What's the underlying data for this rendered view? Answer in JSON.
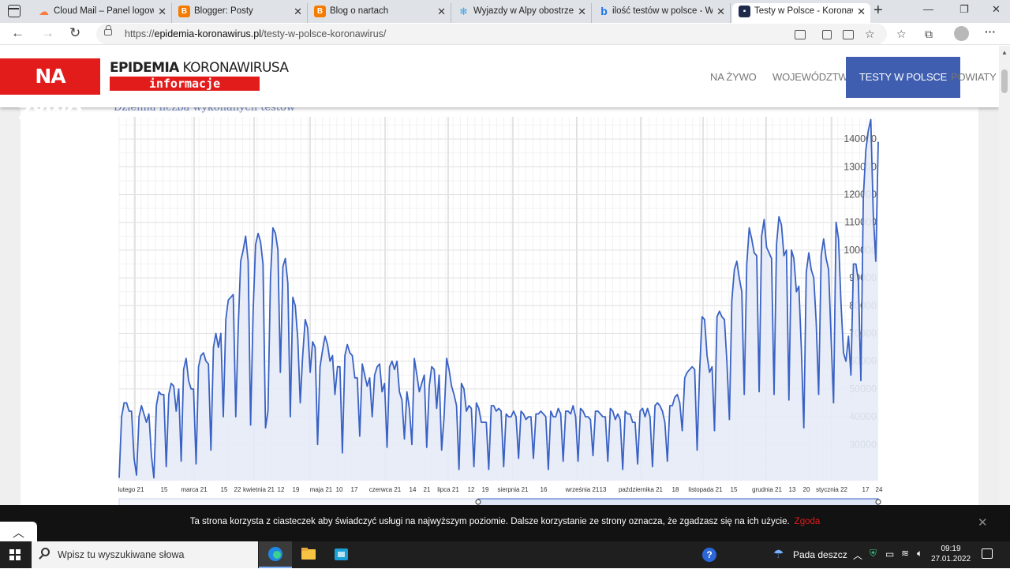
{
  "browser": {
    "tabs": [
      {
        "label": "Cloud Mail – Panel logowania",
        "favicon": "cloud-icon",
        "color": "#ff7a3d"
      },
      {
        "label": "Blogger: Posty",
        "favicon": "blogger-icon",
        "color": "#f57c00"
      },
      {
        "label": "Blog o nartach",
        "favicon": "blogger-icon",
        "color": "#f57c00"
      },
      {
        "label": "Wyjazdy w Alpy obostrzenia",
        "favicon": "snowflake-icon",
        "color": "#3aa0e0"
      },
      {
        "label": "ilość testów w polsce - Wyszukiwanie",
        "favicon": "bing-icon",
        "color": "#1a73e8"
      },
      {
        "label": "Testy w Polsce - Koronawirus",
        "favicon": "site-icon",
        "color": "#1e2a4a"
      }
    ],
    "url_prefix": "https://",
    "url_domain": "epidemia-koronawirus.pl",
    "url_path": "/testy-w-polsce-koronawirus/"
  },
  "site": {
    "live_badge": "NA ŻYWO",
    "logo_bold": "EPIDEMIA",
    "logo_light": "KORONAWIRUSA",
    "logo_sub": "informacje",
    "accent_color": "#e21b1b",
    "nav_active_color": "#3f5eb0",
    "menu": [
      "NA ŻYWO",
      "WOJEWÓDZTWA",
      "TESTY W POLSCE",
      "POWIATY"
    ],
    "chart_title_partial": "Dzienna liczba wykonanych testów"
  },
  "chart_data": {
    "type": "area",
    "y_ticks": [
      30000,
      40000,
      50000,
      60000,
      70000,
      80000,
      90000,
      100000,
      110000,
      120000,
      130000,
      140000
    ],
    "ylim": [
      17000,
      148000
    ],
    "y_axis_position": "right",
    "grid": true,
    "line_color": "#3a62c4",
    "fill_color": "#e6ebf7",
    "x_tick_labels": [
      "lutego 21",
      "15",
      "marca 21",
      "15",
      "22",
      "kwietnia 21",
      "12",
      "19",
      "maja 21",
      "10",
      "17",
      "czerwca 21",
      "14",
      "21",
      "lipca 21",
      "12",
      "19",
      "sierpnia 21",
      "16",
      "września 21",
      "13",
      "października 21",
      "18",
      "listopada 21",
      "15",
      "grudnia 21",
      "13",
      "20",
      "stycznia 22",
      "17",
      "24"
    ],
    "daily_tests_approx": [
      18000,
      40000,
      45000,
      45000,
      42000,
      42000,
      25000,
      19000,
      40000,
      44000,
      41000,
      38000,
      41000,
      26000,
      18000,
      44000,
      49000,
      48000,
      48000,
      22000,
      48000,
      52000,
      51000,
      42000,
      50000,
      24000,
      57000,
      61000,
      53000,
      50000,
      50000,
      23000,
      58000,
      62000,
      63000,
      60000,
      59000,
      28000,
      65000,
      70000,
      65000,
      70000,
      40000,
      75000,
      82000,
      83000,
      84000,
      40000,
      72000,
      96000,
      100000,
      105000,
      96000,
      37000,
      78000,
      102000,
      106000,
      103000,
      95000,
      36000,
      42000,
      90000,
      108000,
      106000,
      100000,
      56000,
      94000,
      97000,
      88000,
      40000,
      83000,
      80000,
      68000,
      45000,
      62000,
      75000,
      72000,
      56000,
      67000,
      65000,
      30000,
      58000,
      64000,
      69000,
      66000,
      60000,
      62000,
      48000,
      58000,
      58000,
      27000,
      62000,
      66000,
      63000,
      62000,
      54000,
      54000,
      33000,
      59000,
      55000,
      51000,
      54000,
      40000,
      55000,
      58000,
      59000,
      49000,
      52000,
      29000,
      58000,
      60000,
      57000,
      60000,
      49000,
      46000,
      32000,
      49000,
      43000,
      30000,
      61000,
      55000,
      49000,
      52000,
      55000,
      29000,
      51000,
      58000,
      57000,
      43000,
      55000,
      28000,
      40000,
      61000,
      57000,
      51000,
      48000,
      44000,
      21000,
      52000,
      50000,
      42000,
      44000,
      43000,
      22000,
      45000,
      43000,
      38000,
      38000,
      38000,
      21000,
      44000,
      44000,
      42000,
      43000,
      42000,
      22000,
      41000,
      40000,
      40000,
      42000,
      40000,
      25000,
      42000,
      41000,
      39000,
      40000,
      40000,
      25000,
      41000,
      41000,
      42000,
      41000,
      40000,
      21000,
      42000,
      40000,
      40000,
      43000,
      41000,
      24000,
      42000,
      42000,
      41000,
      44000,
      40000,
      24000,
      43000,
      42000,
      40000,
      40000,
      39000,
      26000,
      42000,
      42000,
      41000,
      40000,
      40000,
      24000,
      43000,
      42000,
      39000,
      41000,
      39000,
      21000,
      42000,
      41000,
      41000,
      38000,
      38000,
      23000,
      42000,
      43000,
      40000,
      43000,
      40000,
      22000,
      44000,
      45000,
      44000,
      42000,
      38000,
      24000,
      44000,
      44000,
      47000,
      48000,
      45000,
      35000,
      54000,
      56000,
      57000,
      58000,
      57000,
      28000,
      56000,
      76000,
      75000,
      62000,
      56000,
      58000,
      35000,
      76000,
      78000,
      76000,
      75000,
      60000,
      39000,
      82000,
      93000,
      96000,
      90000,
      85000,
      48000,
      95000,
      108000,
      104000,
      99000,
      98000,
      49000,
      105000,
      111000,
      101000,
      99000,
      97000,
      48000,
      102000,
      112000,
      109000,
      98000,
      100000,
      46000,
      100000,
      97000,
      85000,
      87000,
      65000,
      36000,
      92000,
      99000,
      93000,
      90000,
      74000,
      48000,
      98000,
      104000,
      97000,
      93000,
      68000,
      45000,
      110000,
      104000,
      81000,
      63000,
      60000,
      69000,
      55000,
      95000,
      95000,
      89000,
      53000,
      119000,
      136000,
      143000,
      147000,
      113000,
      96000,
      139000
    ]
  },
  "cookie_banner": {
    "text": "Ta strona korzysta z ciasteczek aby świadczyć usługi na najwyższym poziomie. Dalsze korzystanie ze strony oznacza, że zgadzasz się na ich użycie.",
    "accept": "Zgoda"
  },
  "taskbar": {
    "search_placeholder": "Wpisz tu wyszukiwane słowa",
    "weather": "Pada deszcz",
    "time": "09:19",
    "date": "27.01.2022"
  }
}
